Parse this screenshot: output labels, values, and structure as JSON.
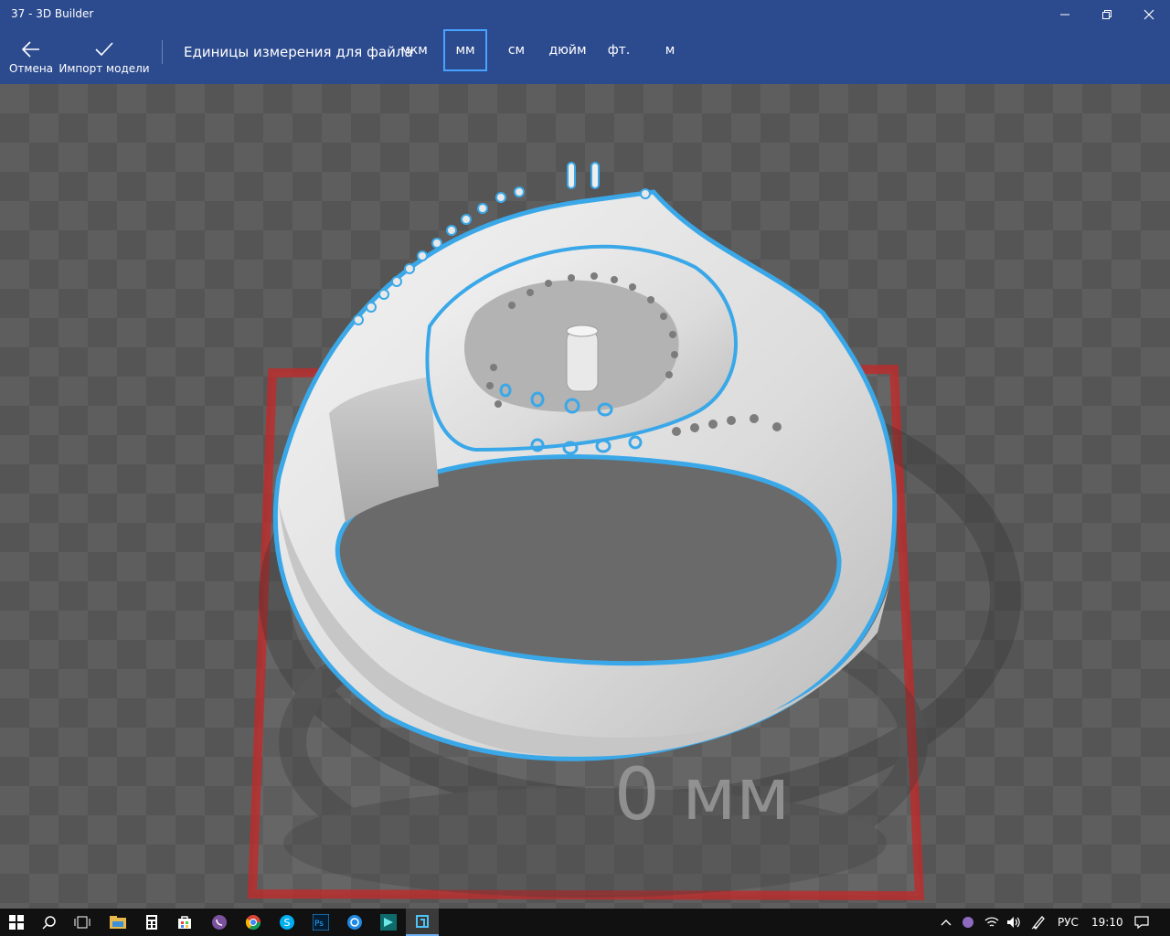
{
  "window": {
    "title": "37 - 3D Builder"
  },
  "toolbar": {
    "cancel_label": "Отмена",
    "import_label": "Импорт модели",
    "units_label": "Единицы измерения для файла",
    "units": [
      "мкм",
      "мм",
      "см",
      "дюйм",
      "фт.",
      "м"
    ],
    "selected_unit": "мм"
  },
  "viewport": {
    "dimension_label": "0 мм"
  },
  "colors": {
    "accent": "#2c4b8f",
    "selection": "#47a3ff",
    "outline": "#3aa8e8",
    "platform_border": "#c62828"
  },
  "taskbar": {
    "icons": [
      "windows-start-icon",
      "search-icon",
      "task-view-icon",
      "file-explorer-icon",
      "calculator-icon",
      "store-icon",
      "viber-icon",
      "chrome-icon",
      "skype-icon",
      "photoshop-icon",
      "app-icon",
      "app-icon-2",
      "3d-builder-icon"
    ],
    "language": "РУС",
    "time": "19:10"
  }
}
